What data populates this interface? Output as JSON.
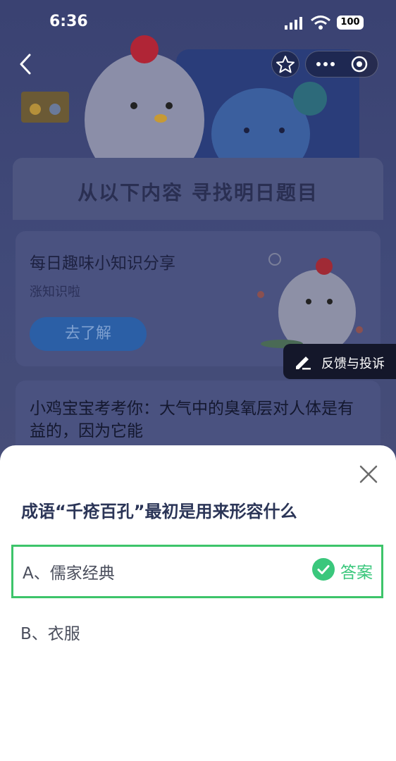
{
  "status_bar": {
    "time": "6:36",
    "battery": "100"
  },
  "banner": {
    "title": "从以下内容  寻找明日题目"
  },
  "card1": {
    "title": "每日趣味小知识分享",
    "subtitle": "涨知识啦",
    "button": "去了解"
  },
  "feedback": {
    "label": "反馈与投诉"
  },
  "card2": {
    "question": "小鸡宝宝考考你：大气中的臭氧层对人体是有益的，因为它能"
  },
  "quiz": {
    "question": "成语“千疮百孔”最初是用来形容什么",
    "options": [
      {
        "label": "A、儒家经典",
        "badge": "答案",
        "correct": true
      },
      {
        "label": "B、衣服"
      }
    ]
  },
  "colors": {
    "accent_green": "#3ac77c",
    "selected_border": "#3dc46a"
  },
  "icons": [
    "back-arrow-icon",
    "star-icon",
    "more-icon",
    "record-icon",
    "edit-icon",
    "close-icon",
    "check-circle-icon"
  ]
}
